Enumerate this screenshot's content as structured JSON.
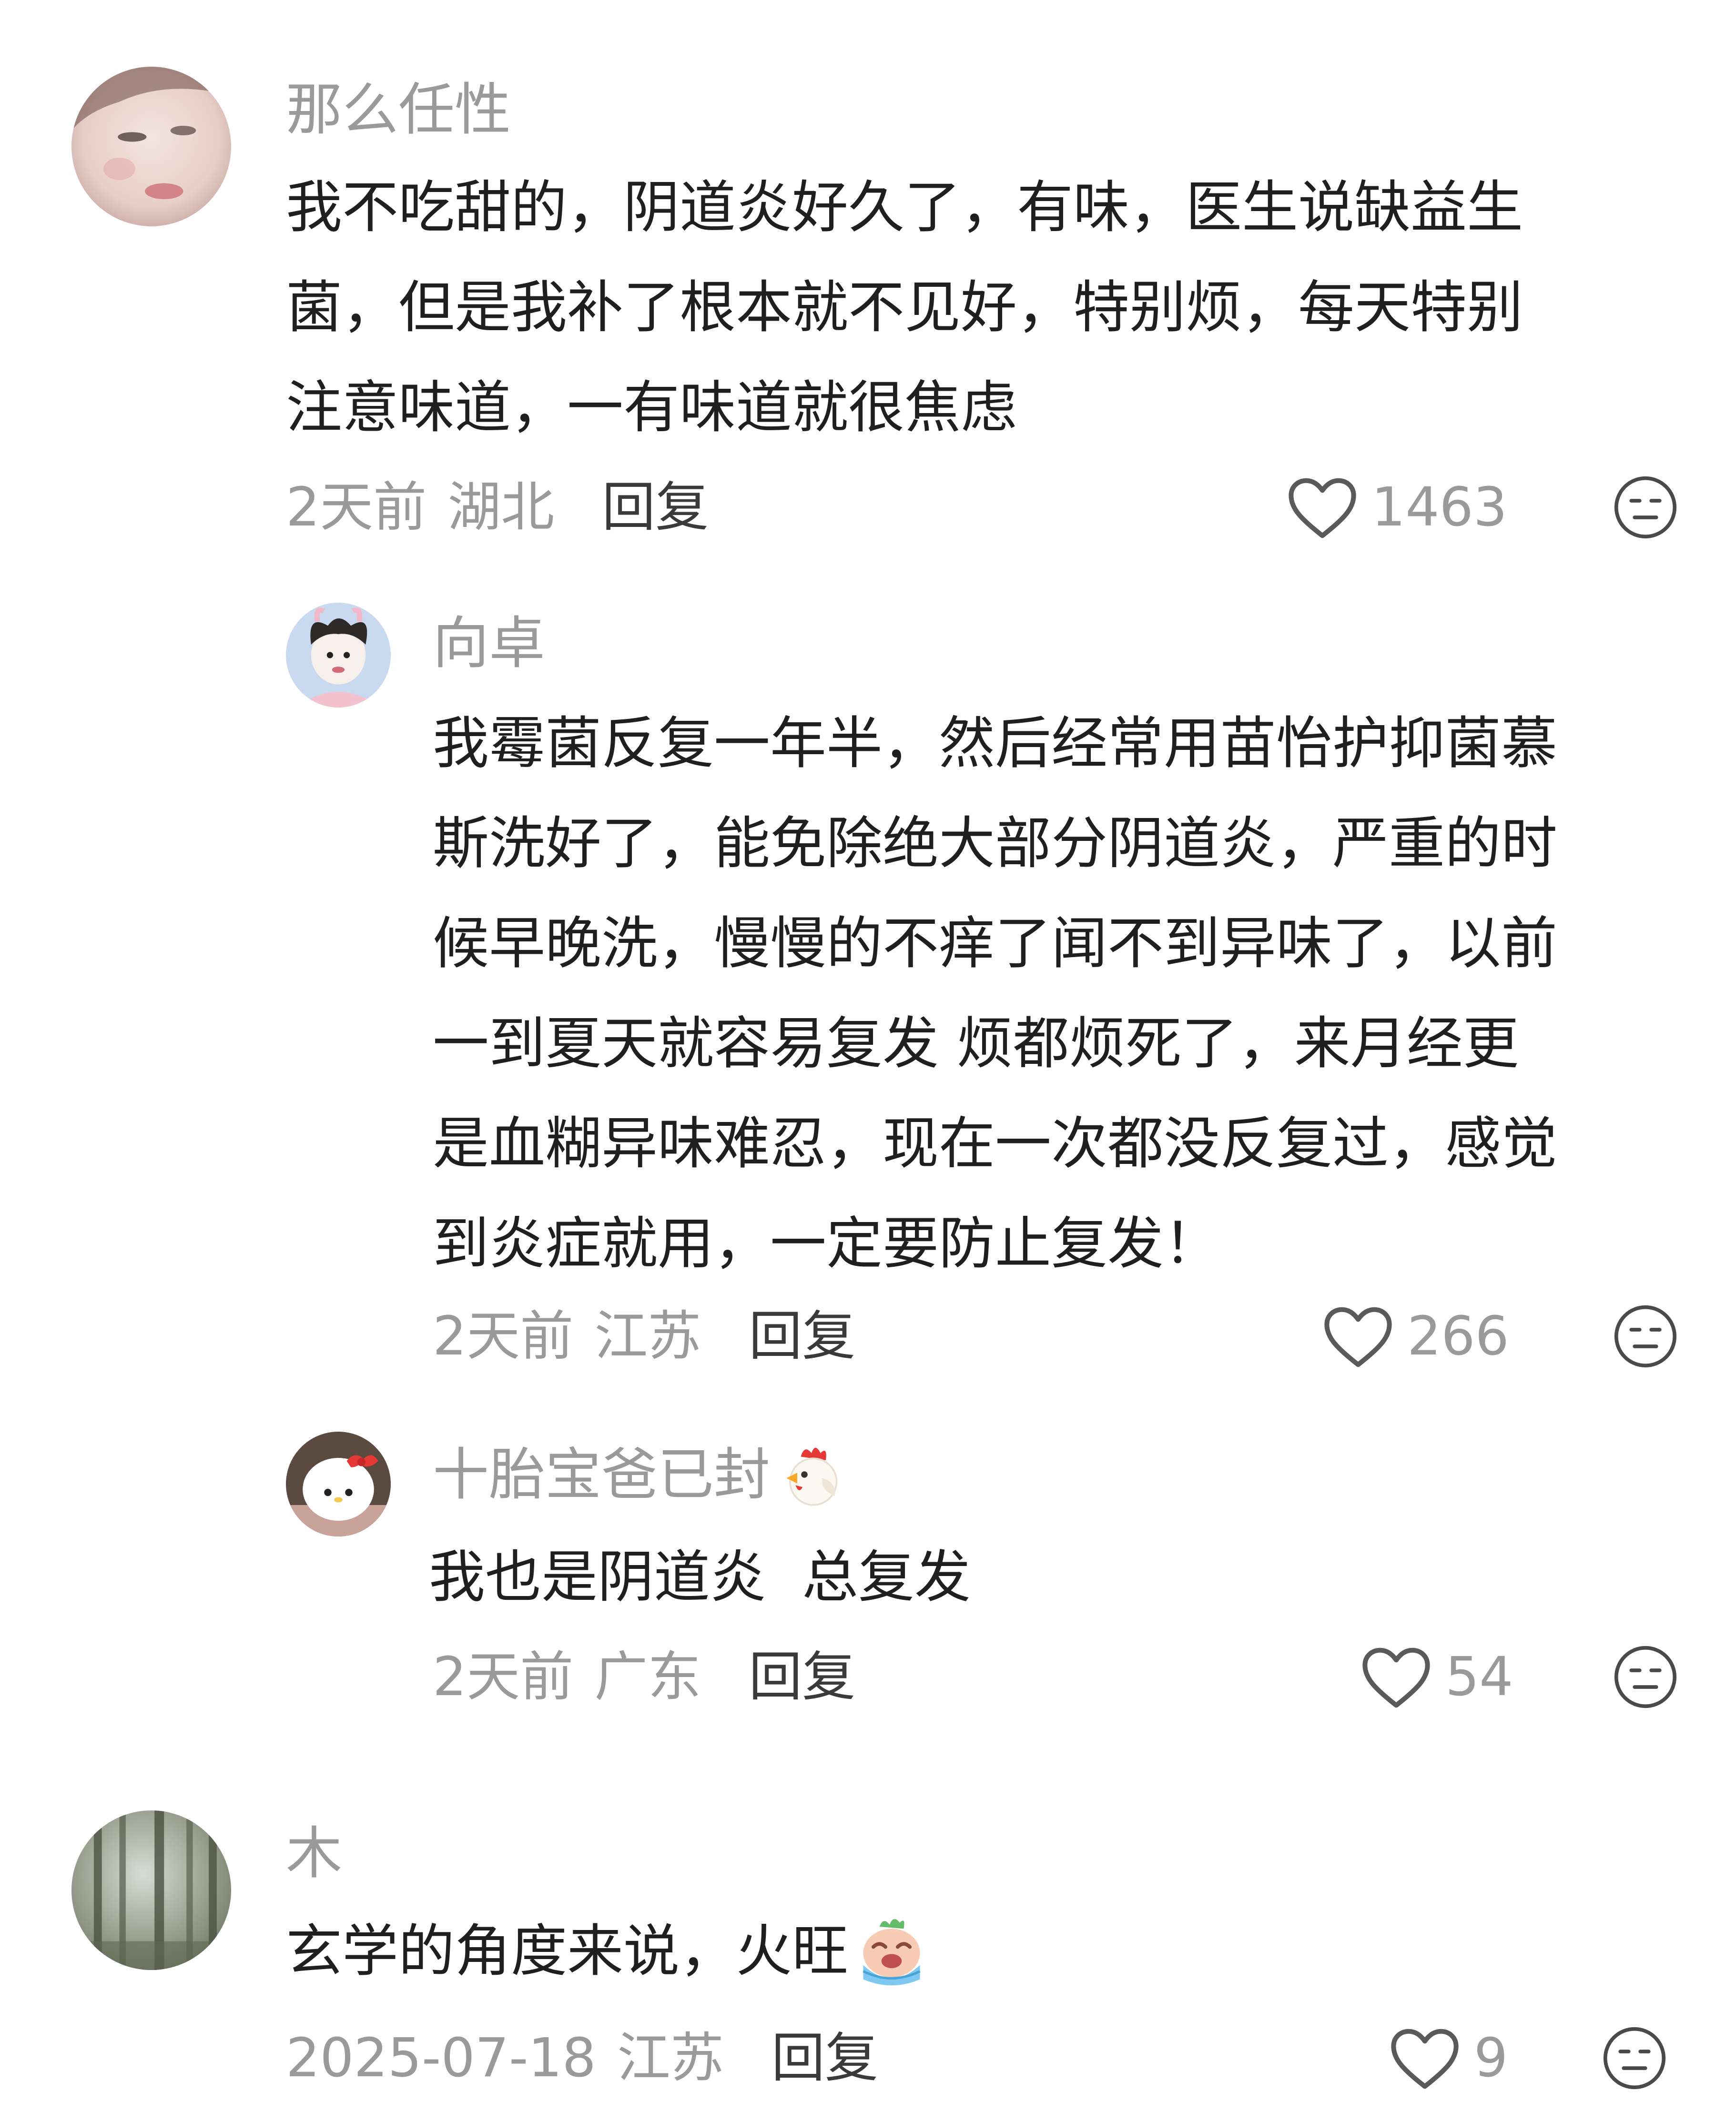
{
  "comments": [
    {
      "user": "那么任性",
      "lines": [
        "我不吃甜的，阴道炎好久了，有味，医生说缺益生",
        "菌，但是我补了根本就不见好，特别烦，每天特别",
        "注意味道，一有味道就很焦虑"
      ],
      "time": "2天前",
      "location": "湖北",
      "reply": "回复",
      "likes": "1463"
    },
    {
      "user": "向卓",
      "lines": [
        "我霉菌反复一年半，然后经常用苗怡护抑菌慕",
        "斯洗好了，能免除绝大部分阴道炎，严重的时",
        "候早晚洗，慢慢的不痒了闻不到异味了，以前",
        "一到夏天就容易复发 烦都烦死了，来月经更",
        "是血糊异味难忍，现在一次都没反复过，感觉",
        "到炎症就用，一定要防止复发！"
      ],
      "time": "2天前",
      "location": "江苏",
      "reply": "回复",
      "likes": "266"
    },
    {
      "user": "十胎宝爸已封",
      "lines": [
        "我也是阴道炎  总复发"
      ],
      "time": "2天前",
      "location": "广东",
      "reply": "回复",
      "likes": "54"
    },
    {
      "user": "木",
      "lines": [
        "玄学的角度来说，火旺"
      ],
      "time": "2025-07-18",
      "location": "江苏",
      "reply": "回复",
      "likes": "9"
    }
  ],
  "icons": {
    "like": "heart-outline-icon",
    "dislike": "neutral-face-icon",
    "chicken_emoji": "chicken-emoji",
    "crying_emoji": "crying-emoji"
  },
  "colors": {
    "username": "#9a9a9a",
    "text": "#1f1f1f",
    "meta": "#9a9a9a",
    "reply": "#3a3a3a"
  }
}
